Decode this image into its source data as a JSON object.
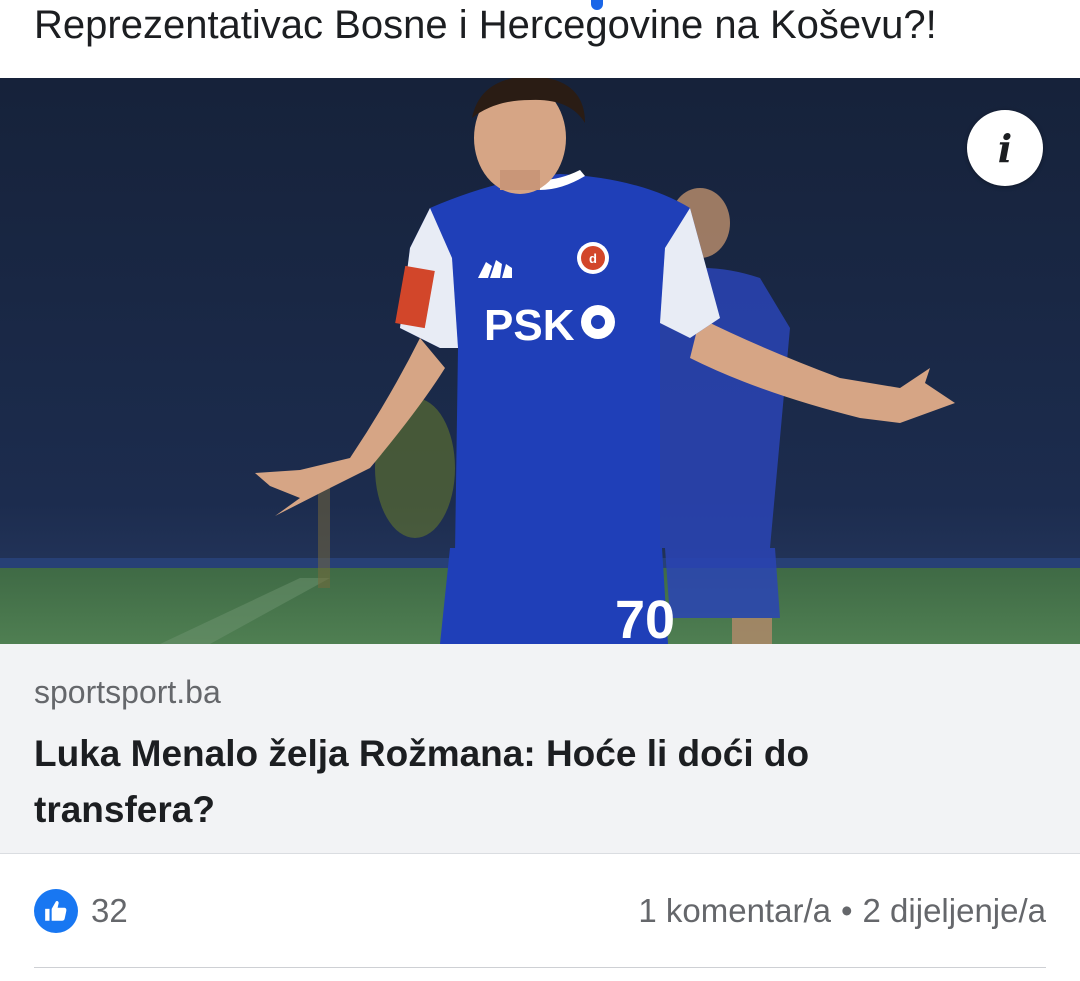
{
  "post": {
    "text": "Reprezentativac Bosne i Hercegovine na Koševu?!"
  },
  "media": {
    "image_alt": "Footballer in blue Dinamo Zagreb kit gesturing with open arms",
    "jersey_sponsor": "PSK",
    "jersey_number": "70",
    "info_icon": "info-icon",
    "info_glyph": "i"
  },
  "link_preview": {
    "domain": "sportsport.ba",
    "title": "Luka Menalo želja Rožmana: Hoće li doći do transfera?"
  },
  "footer": {
    "like_icon": "thumbs-up-icon",
    "like_count": "32",
    "comments": "1 komentar/a",
    "separator": "•",
    "shares": "2 dijeljenje/a"
  },
  "colors": {
    "accent": "#1877f2",
    "muted_text": "#65676b",
    "card_bg": "#f2f3f5",
    "jersey_blue": "#1f3fb8"
  }
}
